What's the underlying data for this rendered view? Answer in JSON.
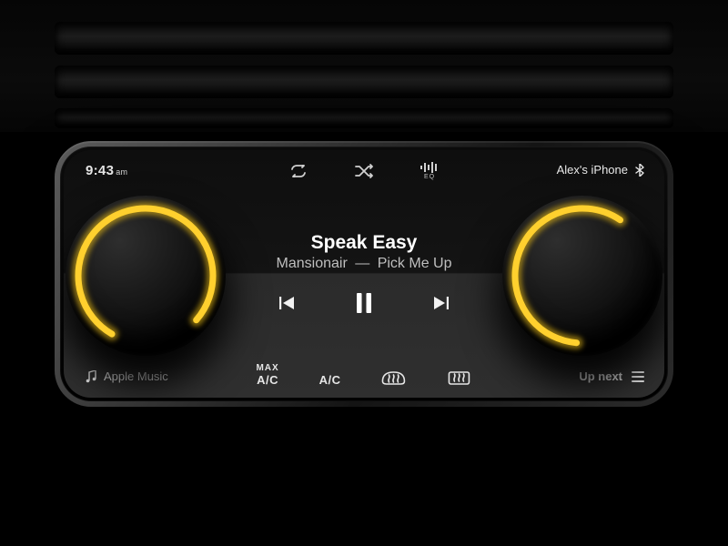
{
  "clock": {
    "time": "9:43",
    "ampm": "am"
  },
  "top_icons": {
    "repeat_name": "repeat",
    "shuffle_name": "shuffle",
    "eq_label": "EQ"
  },
  "device": {
    "name": "Alex's iPhone"
  },
  "now_playing": {
    "title": "Speak Easy",
    "artist": "Mansionair",
    "album": "Pick Me Up",
    "separator": "—"
  },
  "bottom": {
    "source": "Apple Music",
    "max_label_top": "MAX",
    "max_label_bottom": "A/C",
    "ac_label": "A/C",
    "upnext_label": "Up next"
  },
  "dials": {
    "left_fraction": 0.78,
    "right_fraction": 0.58
  },
  "colors": {
    "accent": "#f5c518"
  }
}
